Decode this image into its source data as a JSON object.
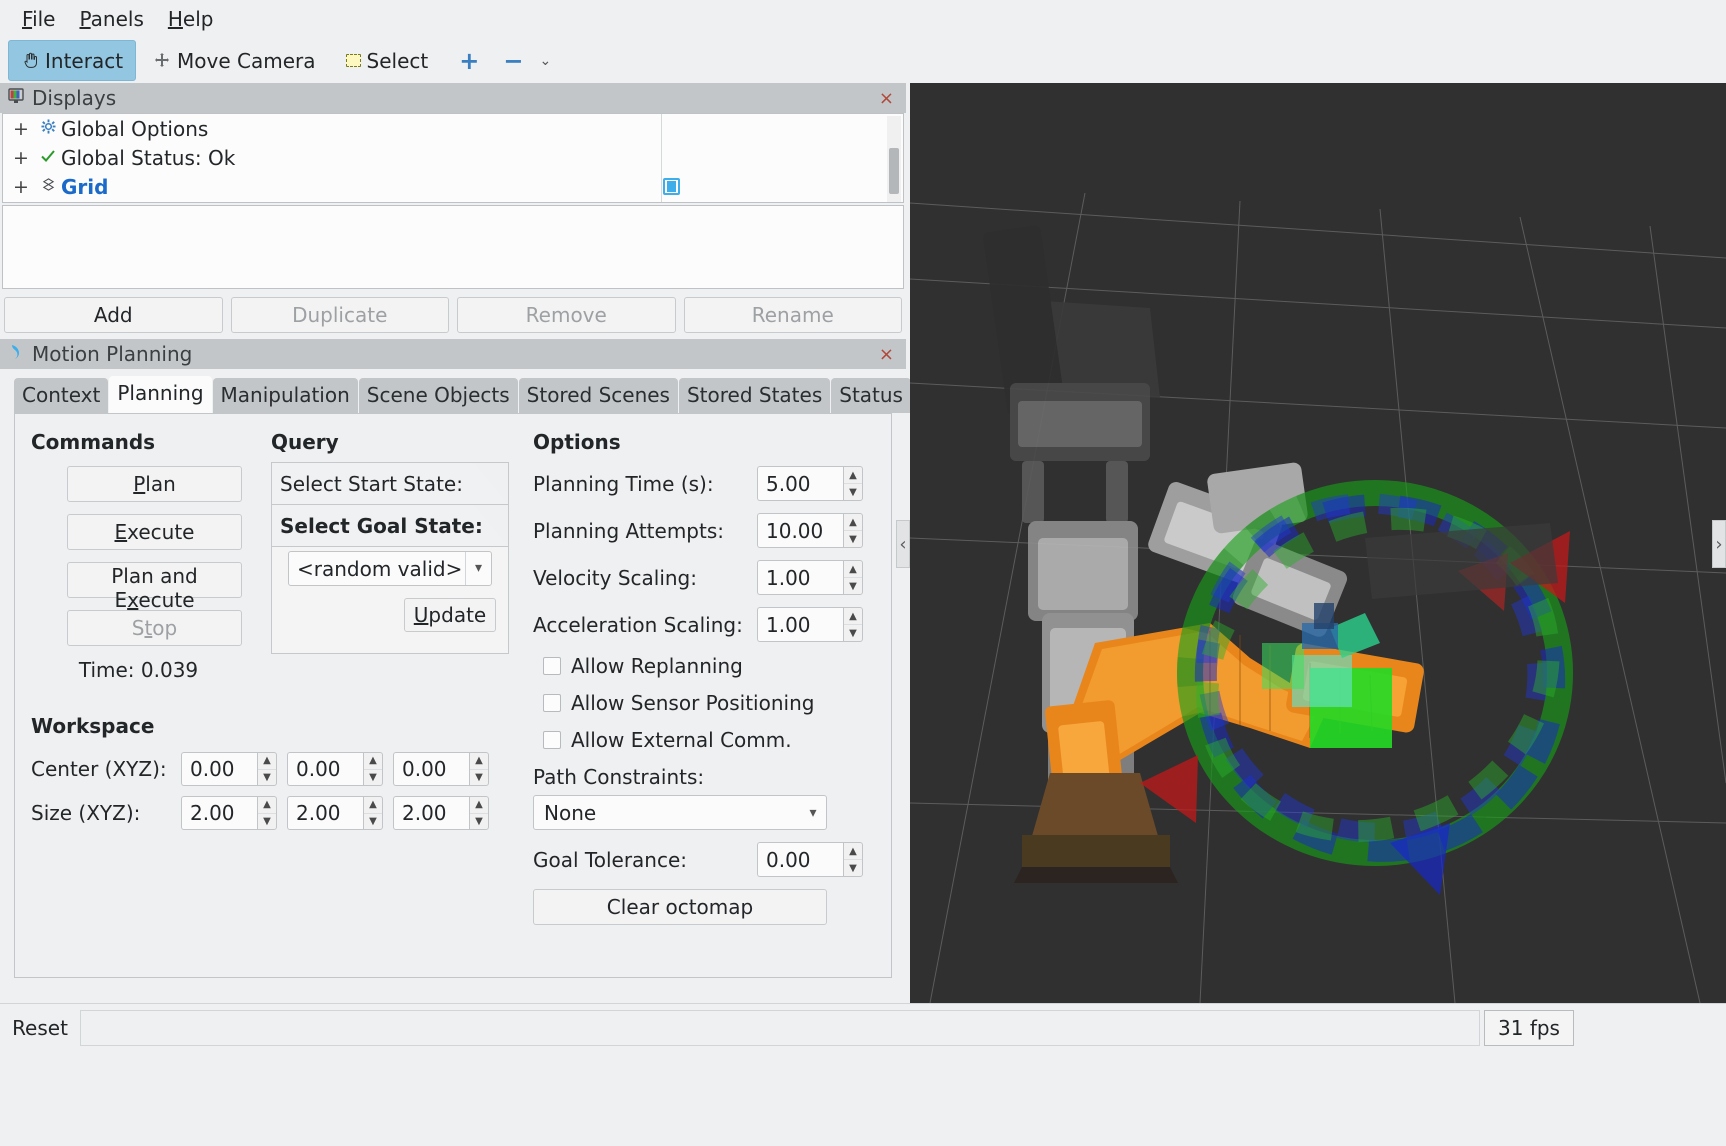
{
  "menu": {
    "items": [
      {
        "label": "File",
        "accel": "F"
      },
      {
        "label": "Panels",
        "accel": "P"
      },
      {
        "label": "Help",
        "accel": "H"
      }
    ]
  },
  "toolbar": {
    "interact": "Interact",
    "move_camera": "Move Camera",
    "select": "Select",
    "plus": "+",
    "minus": "−",
    "chevron": "⌄",
    "active": "Interact",
    "active_color": "#93c6e0"
  },
  "displays": {
    "title": "Displays",
    "close": "×",
    "tree": [
      {
        "expander": "+",
        "icon": "gear-icon",
        "label": "Global Options",
        "bold": false,
        "checkbox": false
      },
      {
        "expander": "+",
        "icon": "check-icon",
        "label": "Global Status: Ok",
        "bold": false,
        "checkbox": false
      },
      {
        "expander": "+",
        "icon": "grid-icon",
        "label": "Grid",
        "bold": true,
        "checkbox": true
      }
    ],
    "buttons": [
      {
        "label": "Add",
        "enabled": true
      },
      {
        "label": "Duplicate",
        "enabled": false
      },
      {
        "label": "Remove",
        "enabled": false
      },
      {
        "label": "Rename",
        "enabled": false
      }
    ]
  },
  "motion_planning": {
    "title": "Motion Planning",
    "close": "×",
    "tabs": [
      {
        "label": "Context",
        "active": false
      },
      {
        "label": "Planning",
        "active": true
      },
      {
        "label": "Manipulation",
        "active": false
      },
      {
        "label": "Scene Objects",
        "active": false
      },
      {
        "label": "Stored Scenes",
        "active": false
      },
      {
        "label": "Stored States",
        "active": false
      },
      {
        "label": "Status",
        "active": false
      }
    ],
    "commands": {
      "title": "Commands",
      "buttons": [
        {
          "pre": "",
          "accel": "P",
          "post": "lan",
          "enabled": true
        },
        {
          "pre": "",
          "accel": "E",
          "post": "xecute",
          "enabled": true
        },
        {
          "pre": "Plan and E",
          "accel": "x",
          "post": "ecute",
          "enabled": true
        },
        {
          "pre": "S",
          "accel": "t",
          "post": "op",
          "enabled": false
        }
      ],
      "time_label": "Time: 0.039"
    },
    "query": {
      "title": "Query",
      "start_state_label": "Select Start State:",
      "goal_state_label": "Select Goal State:",
      "goal_state_value": "<random valid>",
      "update_pre": "",
      "update_accel": "U",
      "update_post": "pdate"
    },
    "options": {
      "title": "Options",
      "fields": [
        {
          "label": "Planning Time (s):",
          "value": "5.00"
        },
        {
          "label": "Planning Attempts:",
          "value": "10.00"
        },
        {
          "label": "Velocity Scaling:",
          "value": "1.00"
        },
        {
          "label": "Acceleration Scaling:",
          "value": "1.00"
        }
      ],
      "checkboxes": [
        {
          "label": "Allow Replanning",
          "checked": false
        },
        {
          "label": "Allow Sensor Positioning",
          "checked": false
        },
        {
          "label": "Allow External Comm.",
          "checked": false
        }
      ],
      "path_constraints_label": "Path Constraints:",
      "path_constraints_value": "None",
      "goal_tolerance_label": "Goal Tolerance:",
      "goal_tolerance_value": "0.00",
      "clear_octomap_label": "Clear octomap"
    },
    "workspace": {
      "title": "Workspace",
      "center_label": "Center (XYZ):",
      "center_values": [
        "0.00",
        "0.00",
        "0.00"
      ],
      "size_label": "Size (XYZ):",
      "size_values": [
        "2.00",
        "2.00",
        "2.00"
      ]
    }
  },
  "view3d": {
    "handle_left": "‹",
    "handle_right": "›",
    "background_color": "#303030",
    "robot_color": "#e8861b",
    "marker_ring_colors": [
      "#18a018",
      "#1828c8",
      "#c81818"
    ]
  },
  "statusbar": {
    "reset_label": "Reset",
    "status_text": "",
    "fps": "31 fps"
  }
}
